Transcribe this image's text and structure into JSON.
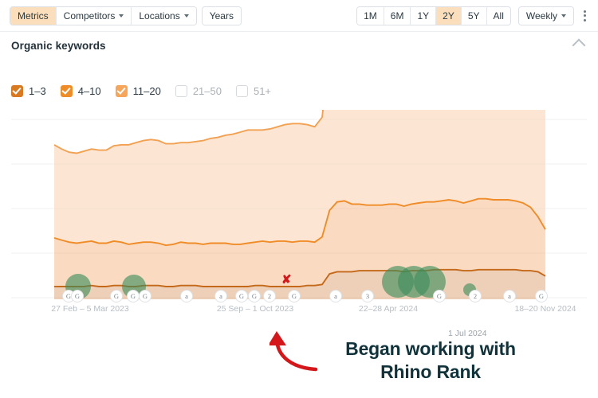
{
  "toolbar": {
    "left_tabs": [
      {
        "label": "Metrics",
        "active": true,
        "caret": false
      },
      {
        "label": "Competitors",
        "active": false,
        "caret": true
      },
      {
        "label": "Locations",
        "active": false,
        "caret": true
      }
    ],
    "years_tab": {
      "label": "Years"
    },
    "ranges": [
      {
        "label": "1M",
        "active": false
      },
      {
        "label": "6M",
        "active": false
      },
      {
        "label": "1Y",
        "active": false
      },
      {
        "label": "2Y",
        "active": true
      },
      {
        "label": "5Y",
        "active": false
      },
      {
        "label": "All",
        "active": false
      }
    ],
    "granularity": {
      "label": "Weekly"
    },
    "menu_icon": "kebab-menu-icon"
  },
  "section": {
    "title": "Organic keywords",
    "collapse_icon": "chevron-up-icon"
  },
  "legend": {
    "items": [
      {
        "label": "1–3",
        "checked": true,
        "color": "#d87a22"
      },
      {
        "label": "4–10",
        "checked": true,
        "color": "#f08c28"
      },
      {
        "label": "11–20",
        "checked": true,
        "color": "#f5a65a"
      },
      {
        "label": "21–50",
        "checked": false,
        "color": "#d5d9dd"
      },
      {
        "label": "51+",
        "checked": false,
        "color": "#d5d9dd"
      }
    ]
  },
  "annotation": {
    "title_line1": "Began working with",
    "title_line2": "Rhino Rank",
    "marker": "✘",
    "arrow_color": "#d4171a",
    "text_color": "#10323a",
    "floating_date": "1 Jul 2024"
  },
  "chart_data": {
    "type": "area",
    "title": "Organic keywords",
    "stacked": true,
    "xlabel": "",
    "ylabel": "",
    "grid": true,
    "legend_position": "top",
    "x_tick_labels": [
      "27 Feb – 5 Mar 2023",
      "25 Sep – 1 Oct 2023",
      "22–28 Apr 2024",
      "18–20 Nov 2024"
    ],
    "x_tick_positions": [
      113,
      320,
      487,
      684
    ],
    "gridline_y": [
      150,
      206,
      262,
      318,
      374
    ],
    "colors": {
      "series_1_3_line": "#c4691a",
      "series_1_3_fill": "rgba(214,140,86,0.42)",
      "series_4_10_line": "#f08c28",
      "series_4_10_fill": "rgba(243,163,98,0.40)",
      "series_11_20_line": "#f2a152",
      "series_11_20_fill": "rgba(248,196,150,0.42)",
      "accent": "#f08c28",
      "active_tab": "#fbdfbc"
    },
    "series": [
      {
        "name": "1–3",
        "values": [
          12,
          12,
          12,
          12,
          12,
          13,
          12,
          12,
          13,
          13,
          12,
          12,
          13,
          13,
          13,
          12,
          12,
          13,
          13,
          13,
          12,
          12,
          12,
          12,
          12,
          12,
          12,
          13,
          13,
          12,
          12,
          12,
          12,
          12,
          13,
          13,
          14,
          24,
          26,
          26,
          26,
          27,
          27,
          27,
          27,
          27,
          27,
          26,
          27,
          27,
          27,
          28,
          28,
          28,
          28,
          27,
          27,
          28,
          28,
          28,
          28,
          28,
          28,
          27,
          27,
          26,
          22
        ]
      },
      {
        "name": "4–10",
        "values": [
          46,
          44,
          42,
          41,
          42,
          42,
          41,
          41,
          42,
          41,
          40,
          41,
          41,
          41,
          40,
          39,
          40,
          41,
          40,
          40,
          40,
          41,
          41,
          41,
          40,
          40,
          41,
          41,
          42,
          42,
          43,
          43,
          42,
          43,
          42,
          41,
          45,
          60,
          66,
          67,
          64,
          63,
          62,
          62,
          62,
          63,
          63,
          62,
          63,
          64,
          65,
          64,
          65,
          66,
          65,
          64,
          66,
          67,
          67,
          66,
          66,
          66,
          65,
          64,
          60,
          52,
          44
        ]
      },
      {
        "name": "11–20",
        "values": [
          88,
          86,
          85,
          85,
          86,
          87,
          88,
          88,
          90,
          92,
          94,
          95,
          96,
          97,
          97,
          96,
          95,
          94,
          95,
          96,
          98,
          99,
          100,
          102,
          104,
          106,
          107,
          106,
          105,
          107,
          108,
          110,
          112,
          111,
          110,
          109,
          113,
          150,
          156,
          158,
          156,
          152,
          150,
          148,
          150,
          151,
          148,
          146,
          147,
          150,
          153,
          152,
          150,
          152,
          155,
          157,
          156,
          153,
          152,
          155,
          157,
          158,
          156,
          152,
          147,
          138,
          118
        ]
      }
    ],
    "markers": [
      {
        "label": "G",
        "x": 86
      },
      {
        "label": "G",
        "x": 97
      },
      {
        "label": "G",
        "x": 146
      },
      {
        "label": "G",
        "x": 167
      },
      {
        "label": "G",
        "x": 182
      },
      {
        "label": "a",
        "x": 234
      },
      {
        "label": "a",
        "x": 277
      },
      {
        "label": "G",
        "x": 303
      },
      {
        "label": "G",
        "x": 319
      },
      {
        "label": "2",
        "x": 338
      },
      {
        "label": "G",
        "x": 369
      },
      {
        "label": "a",
        "x": 421
      },
      {
        "label": "3",
        "x": 461
      },
      {
        "label": "G",
        "x": 551
      },
      {
        "label": "2",
        "x": 596
      },
      {
        "label": "a",
        "x": 639
      },
      {
        "label": "G",
        "x": 679
      }
    ],
    "blobs": [
      {
        "x": 98,
        "y": 360,
        "size": 32
      },
      {
        "x": 168,
        "y": 360,
        "size": 30
      },
      {
        "x": 499,
        "y": 354,
        "size": 40
      },
      {
        "x": 519,
        "y": 354,
        "size": 40
      },
      {
        "x": 539,
        "y": 354,
        "size": 40
      },
      {
        "x": 589,
        "y": 364,
        "size": 16
      }
    ]
  }
}
